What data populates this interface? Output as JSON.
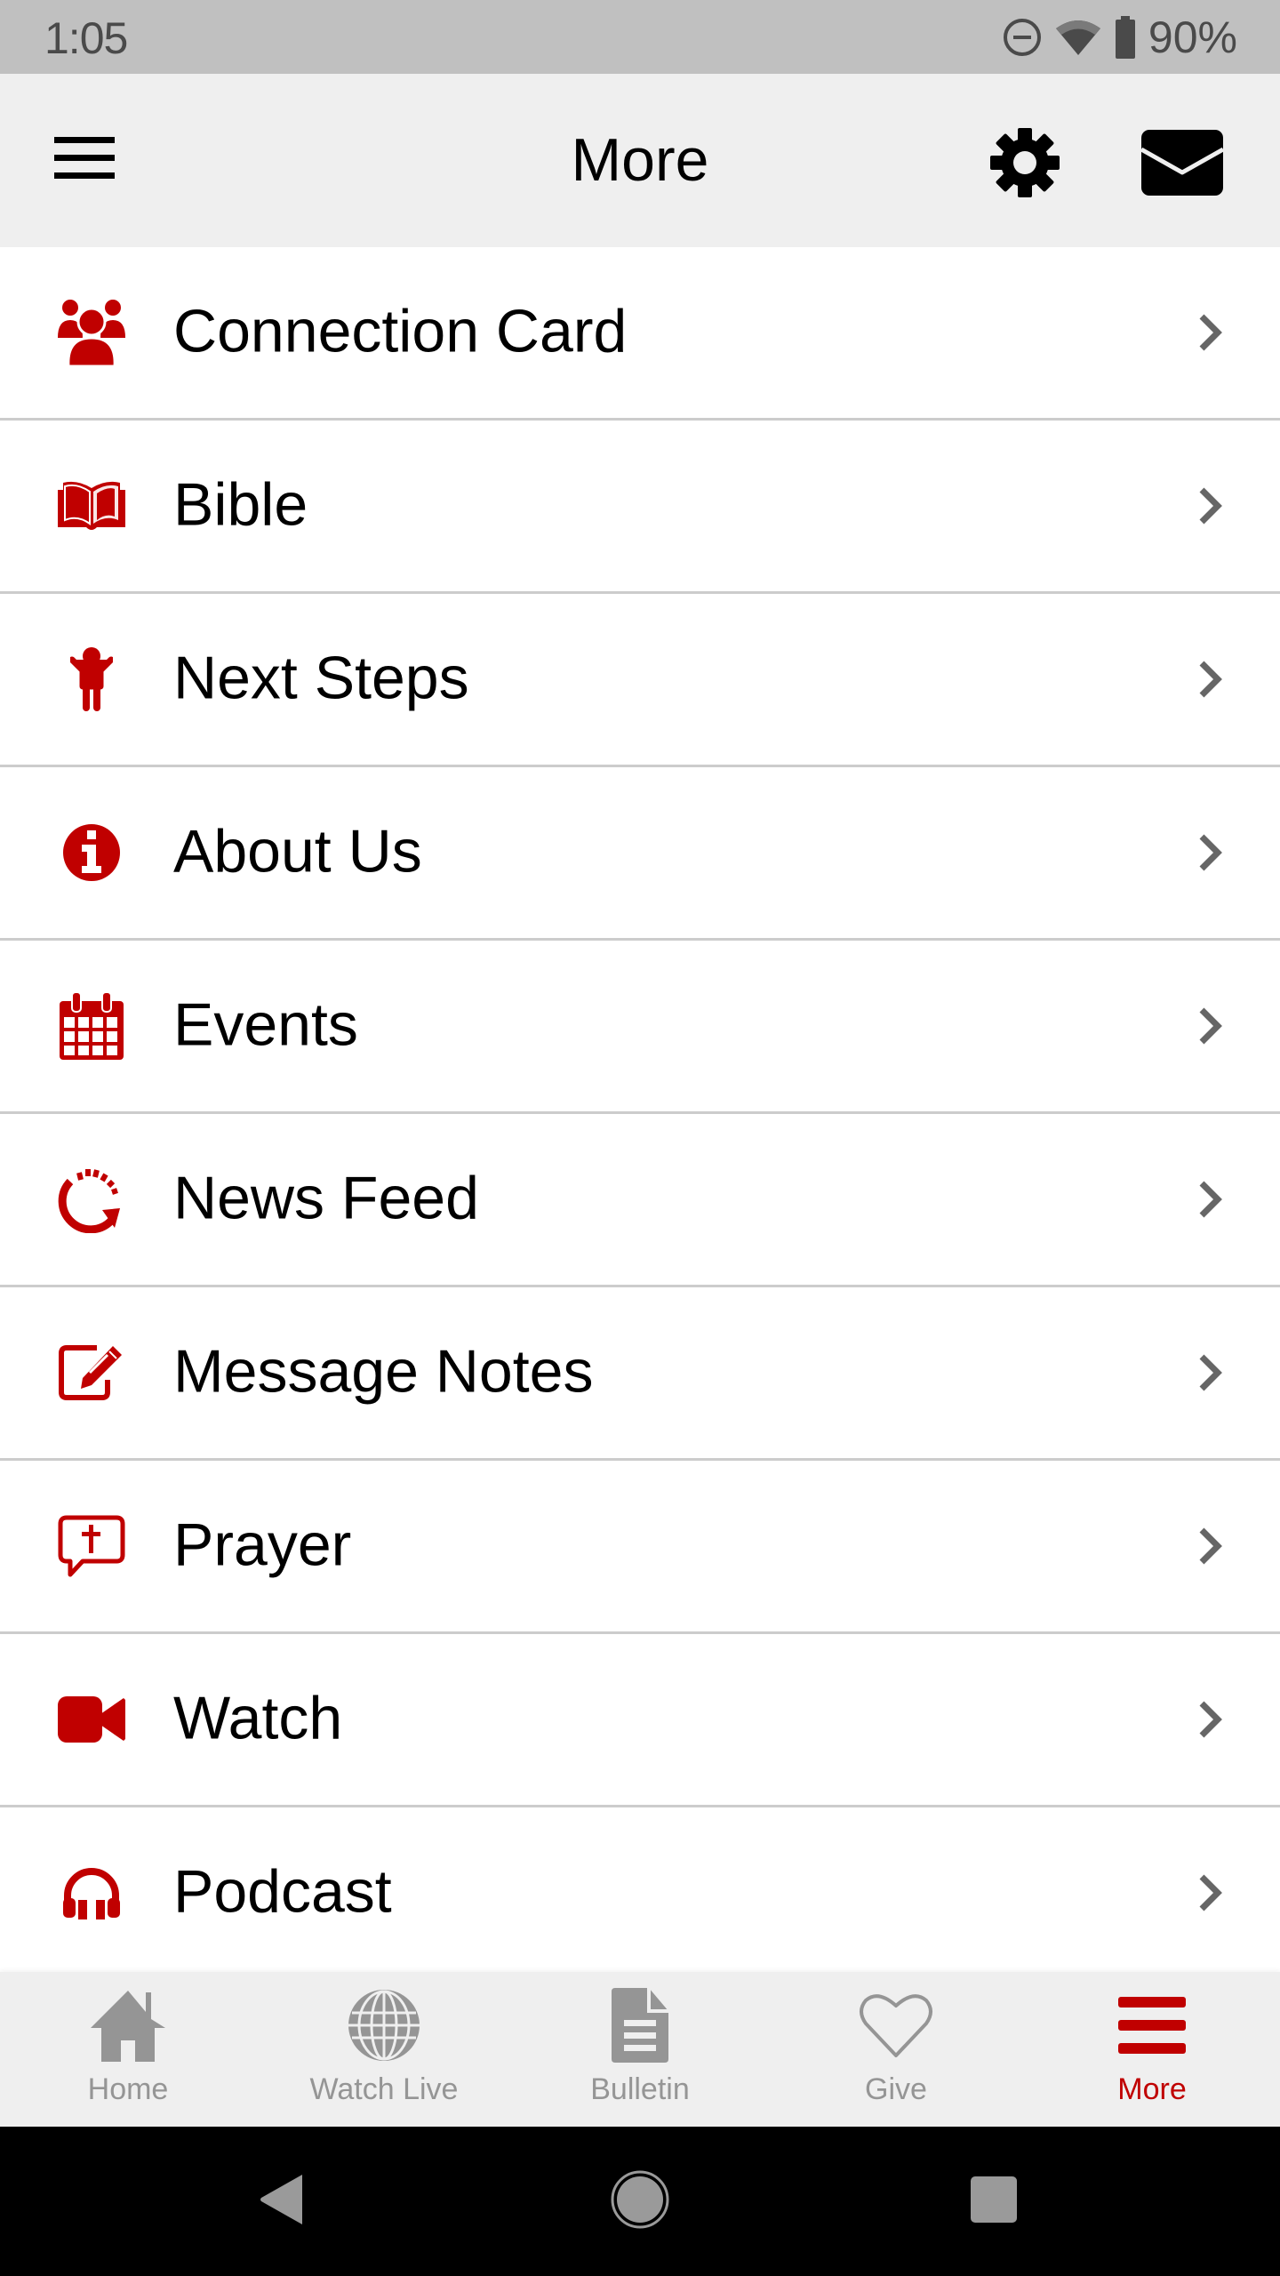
{
  "status_bar": {
    "time": "1:05",
    "battery": "90%",
    "icons": [
      "do-not-disturb-icon",
      "wifi-icon",
      "battery-icon"
    ]
  },
  "app_bar": {
    "title": "More",
    "menu_icon": "hamburger-menu-icon",
    "settings_icon": "gear-icon",
    "mail_icon": "envelope-icon"
  },
  "colors": {
    "accent": "#c00000",
    "status_bar_bg": "#c0c0c0",
    "app_bar_bg": "#efefef",
    "tab_inactive": "#959595",
    "divider": "#cccccc",
    "chevron": "#666666"
  },
  "menu": {
    "items": [
      {
        "label": "Connection Card",
        "icon": "group-icon"
      },
      {
        "label": "Bible",
        "icon": "open-book-icon"
      },
      {
        "label": "Next Steps",
        "icon": "person-arms-raised-icon"
      },
      {
        "label": "About Us",
        "icon": "info-circle-icon"
      },
      {
        "label": "Events",
        "icon": "calendar-icon"
      },
      {
        "label": "News Feed",
        "icon": "refresh-arrow-icon"
      },
      {
        "label": "Message Notes",
        "icon": "edit-note-icon"
      },
      {
        "label": "Prayer",
        "icon": "prayer-bubble-cross-icon"
      },
      {
        "label": "Watch",
        "icon": "video-camera-icon"
      },
      {
        "label": "Podcast",
        "icon": "headphones-icon"
      }
    ]
  },
  "tab_bar": {
    "tabs": [
      {
        "label": "Home",
        "icon": "home-icon",
        "active": false
      },
      {
        "label": "Watch Live",
        "icon": "globe-icon",
        "active": false
      },
      {
        "label": "Bulletin",
        "icon": "document-icon",
        "active": false
      },
      {
        "label": "Give",
        "icon": "heart-outline-icon",
        "active": false
      },
      {
        "label": "More",
        "icon": "hamburger-menu-icon",
        "active": true
      }
    ]
  },
  "nav_bar": {
    "buttons": [
      "back-icon",
      "home-circle-icon",
      "recents-square-icon"
    ]
  }
}
